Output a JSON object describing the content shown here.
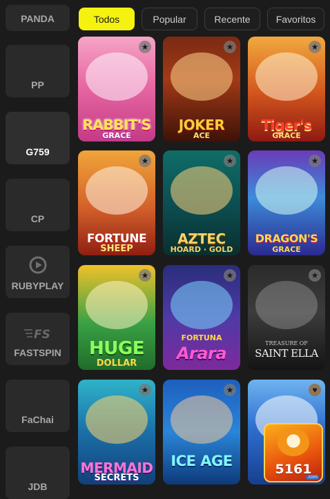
{
  "providers": [
    {
      "label": "PANDA",
      "icon": "none",
      "active": false
    },
    {
      "label": "PP",
      "icon": "none",
      "active": false
    },
    {
      "label": "G759",
      "icon": "none",
      "active": true
    },
    {
      "label": "CP",
      "icon": "none",
      "active": false
    },
    {
      "label": "RUBYPLAY",
      "icon": "play-icon",
      "active": false
    },
    {
      "label": "FASTSPIN",
      "icon": "fastspin-logo-icon",
      "active": false
    },
    {
      "label": "FaChai",
      "icon": "none",
      "active": false
    },
    {
      "label": "JDB",
      "icon": "none",
      "active": false
    }
  ],
  "tabs": [
    {
      "label": "Todos",
      "active": true
    },
    {
      "label": "Popular",
      "active": false
    },
    {
      "label": "Recente",
      "active": false
    },
    {
      "label": "Favoritos",
      "active": false
    }
  ],
  "games": [
    {
      "title": "RABBIT'S",
      "subtitle": "GRACE",
      "fav_icon": "star-icon"
    },
    {
      "title": "JOKER",
      "subtitle": "ACE",
      "fav_icon": "star-icon"
    },
    {
      "title": "Tiger's",
      "subtitle": "GRACE",
      "fav_icon": "star-icon"
    },
    {
      "title": "FORTUNE",
      "subtitle": "SHEEP",
      "fav_icon": "star-icon"
    },
    {
      "title": "AZTEC",
      "subtitle": "HOARD · GOLD",
      "fav_icon": "star-icon"
    },
    {
      "title": "DRAGON'S",
      "subtitle": "GRACE",
      "fav_icon": "star-icon"
    },
    {
      "title": "HUGE",
      "subtitle": "DOLLAR",
      "fav_icon": "star-icon"
    },
    {
      "title": "Arara",
      "subtitle": "FORTUNA",
      "fav_icon": "star-icon"
    },
    {
      "title": "SAINT ELLA",
      "subtitle": "TREASURE OF",
      "fav_icon": "star-icon"
    },
    {
      "title": "MERMAID",
      "subtitle": "SECRETS",
      "fav_icon": "star-icon"
    },
    {
      "title": "ICE AGE",
      "subtitle": "",
      "fav_icon": "star-icon"
    },
    {
      "title": "",
      "subtitle": "",
      "fav_icon": "heart-icon"
    }
  ],
  "overlay_logo": {
    "text": "5161",
    "suffix": ".com"
  }
}
